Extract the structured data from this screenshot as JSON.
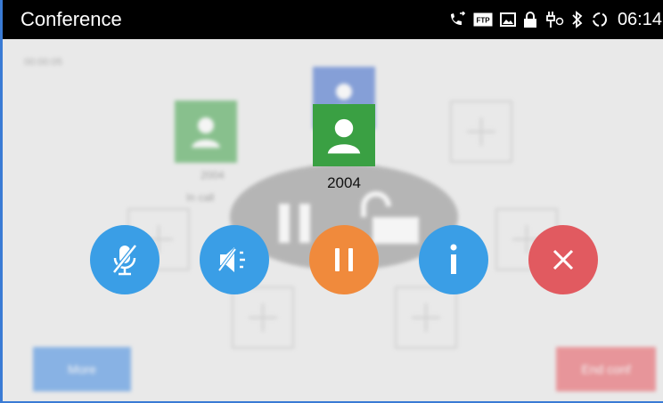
{
  "statusbar": {
    "title": "Conference",
    "time": "06:14",
    "icons": [
      "call-forward-icon",
      "ftp-icon",
      "image-icon",
      "lock-icon",
      "usb-debug-icon",
      "bluetooth-icon",
      "sync-icon"
    ]
  },
  "background": {
    "timer": "00:00:05",
    "participant_label": "2004",
    "participant_status": "In call",
    "more_label": "More",
    "end_conf_label": "End conf"
  },
  "member": {
    "name": "2004"
  },
  "controls": [
    "mute-mic",
    "mute-speaker",
    "hold",
    "info",
    "end"
  ],
  "colors": {
    "blue": "#3a9ee6",
    "orange": "#f08a3c",
    "red": "#e15a60",
    "green": "#3aa043",
    "statusbar": "#000000"
  }
}
